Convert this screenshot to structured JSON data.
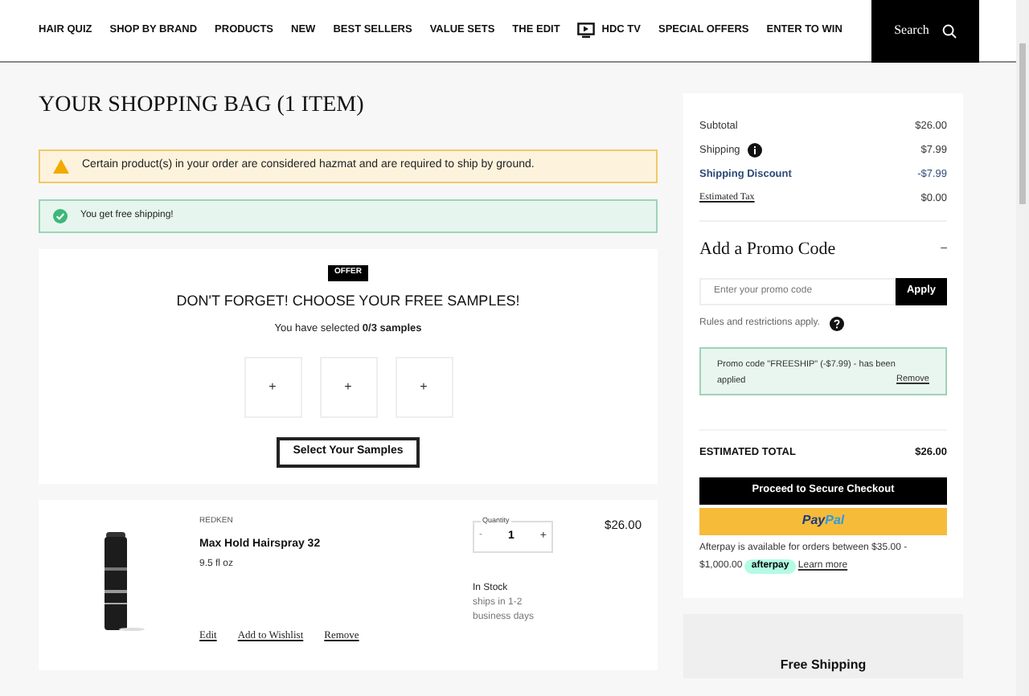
{
  "nav": {
    "items": [
      {
        "label": "HAIR QUIZ",
        "kind": "text"
      },
      {
        "label": "SHOP BY BRAND",
        "kind": "text"
      },
      {
        "label": "PRODUCTS",
        "kind": "text"
      },
      {
        "label": "NEW",
        "kind": "text"
      },
      {
        "label": "BEST SELLERS",
        "kind": "text"
      },
      {
        "label": "VALUE SETS",
        "kind": "text"
      },
      {
        "label": "THE EDIT",
        "kind": "text"
      },
      {
        "label": "HDC TV",
        "kind": "tv"
      },
      {
        "label": "SPECIAL OFFERS",
        "kind": "text"
      },
      {
        "label": "ENTER TO WIN",
        "kind": "text"
      }
    ],
    "search": "Search"
  },
  "page_title": "YOUR SHOPPING BAG (1 ITEM)",
  "alerts": [
    {
      "kind": "warning",
      "text": "Certain product(s) in your order are considered hazmat and are required to ship by ground."
    },
    {
      "kind": "success",
      "text": "You get free shipping!"
    }
  ],
  "samples": {
    "badge": "OFFER",
    "heading": "DON'T FORGET! CHOOSE YOUR FREE SAMPLES!",
    "status": "You have selected **0/3 samples**",
    "slots": [
      "+",
      "+",
      "+"
    ],
    "button": "Select Your Samples"
  },
  "item": {
    "brand": "REDKEN",
    "name": "Max Hold Hairspray 32",
    "size": "9.5 fl oz",
    "quantity_label": "Quantity",
    "decrement": "-",
    "quantity": "1",
    "increment": "+",
    "price": "$26.00",
    "stock": "In Stock",
    "shipping": "ships in 1-2 business days",
    "actions": [
      "Edit",
      "Add to Wishlist",
      "Remove"
    ]
  },
  "summary": {
    "rows": [
      {
        "label": "Subtotal",
        "value": "$26.00",
        "kind": "plain"
      },
      {
        "label": "Shipping",
        "value": "$7.99",
        "kind": "info"
      },
      {
        "label": "Shipping Discount",
        "value": "-$7.99",
        "kind": "discount"
      },
      {
        "label": "Estimated Tax",
        "value": "$0.00",
        "kind": "link"
      }
    ],
    "promo_title": "Add a Promo Code",
    "promo_toggle": "–",
    "promo_placeholder": "Enter your promo code",
    "apply": "Apply",
    "rules": "Rules and restrictions apply.",
    "promo_applied": "Promo code \"FREESHIP\" (-$7.99) - has been applied",
    "remove": "Remove",
    "total_label": "ESTIMATED TOTAL",
    "total": "$26.00",
    "checkout": "Proceed to Secure Checkout",
    "paypal_1": "Pay",
    "paypal_2": "Pal",
    "afterpay_text": "Afterpay is available for orders between $35.00 - $1,000.00",
    "afterpay_badge": "afterpay",
    "learn_more": "Learn more"
  },
  "free_shipping": "Free Shipping"
}
